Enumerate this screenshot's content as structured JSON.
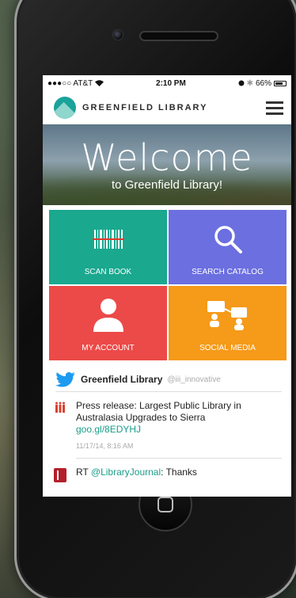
{
  "status": {
    "carrier": "●●●○○ AT&T",
    "time": "2:10 PM",
    "battery": "66%"
  },
  "header": {
    "brand": "GREENFIELD LIBRARY"
  },
  "hero": {
    "title": "Welcome",
    "subtitle": "to Greenfield Library!"
  },
  "tiles": [
    {
      "label": "SCAN BOOK",
      "color": "#1aa88f"
    },
    {
      "label": "SEARCH CATALOG",
      "color": "#6b6fe0"
    },
    {
      "label": "MY ACCOUNT",
      "color": "#ec4a48"
    },
    {
      "label": "SOCIAL MEDIA",
      "color": "#f59a19"
    }
  ],
  "twitter": {
    "name": "Greenfield Library",
    "handle": "@iii_innovative",
    "tweets": [
      {
        "text": "Press release: Largest Public Library in Australasia Upgrades to Sierra",
        "link": "goo.gl/8EDYHJ",
        "date": "11/17/14, 8:16 AM"
      },
      {
        "prefix": "RT ",
        "mention": "@LibraryJournal",
        "text": ": Thanks"
      }
    ]
  }
}
